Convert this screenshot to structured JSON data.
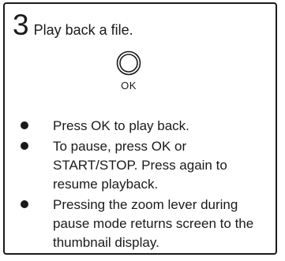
{
  "step": {
    "number": "3",
    "title": "Play back a file."
  },
  "ok_button": {
    "icon": "ok-button-icon",
    "label": "OK"
  },
  "instructions": [
    "Press OK to play back.",
    "To pause, press OK or START/STOP. Press again to resume playback.",
    "Pressing the zoom lever during pause mode returns screen to the thumbnail display."
  ],
  "colors": {
    "ink": "#1a1a1a",
    "background": "#ffffff"
  }
}
